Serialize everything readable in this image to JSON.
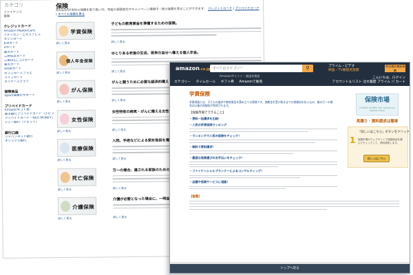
{
  "back_page": {
    "category": "カテゴリ",
    "title": "保険",
    "intro_text": "Amazonが当社の保険を取り扱い中、特定の保険会社やキャンペーン情報中・他の保険を見ることができます：",
    "intro_links": [
      "クレジットカード",
      "プリペイドカード",
      "すべての保険を見る"
    ],
    "sidebar": {
      "top_links": [
        "ファイナンス",
        "保険"
      ],
      "sections": [
        {
          "title": "クレジットカード",
          "items": [
            "Amazon MasterCard",
            "アメリカン・エキスプレス",
            "セゾンカード",
            "JCBカード",
            "dカード",
            "楽天カード",
            "三井住友カード",
            "三菱UFJニコスカード",
            "楽天カード",
            "VIEWカード",
            "セブンカードプラス",
            "ライフカード",
            "ダイナースクラブ"
          ]
        },
        {
          "title": "保険商品",
          "items": [
            "Spark保険のサポート"
          ]
        },
        {
          "title": "プリペイドカード",
          "items": [
            "Amazonギフト券",
            "楽天銀行プリペイドカード（デビット）",
            "プリペイドカード「NEO MONEY」",
            "ソニー銀行（デビット）"
          ]
        },
        {
          "title": "銀行口座",
          "items": [
            "ジャパンネット銀行",
            "オリックス銀行"
          ]
        }
      ]
    },
    "products": [
      {
        "banner": "学資保険",
        "headline": "子どもの教育資金を準備するための保険。",
        "more": "詳しく見る"
      },
      {
        "banner": "個人年金保険",
        "headline": "ゆとりある老後の生活、将来の自分へ備える個人年金。",
        "more": "詳しく見る"
      },
      {
        "banner": "がん保険",
        "headline": "がんと闘うために必要な経済的備え",
        "more": "詳しく見る"
      },
      {
        "banner": "女性保険",
        "headline": "女性特有の病気・がんに備える女性保険",
        "more": "詳しく見る"
      },
      {
        "banner": "医療保険",
        "headline": "入院、手術などによる家計負担を備える医療保険",
        "more": "詳しく見る"
      },
      {
        "banner": "死亡保険",
        "headline": "万一の場合、遺される家族のための保険",
        "more": "詳しく見る"
      },
      {
        "banner": "介護保険",
        "headline": "介護が必要となった場合に、一時金や年金",
        "more": "詳しく見る"
      }
    ]
  },
  "front_page": {
    "nav": {
      "logo": "amazon",
      "logo_sub": ".co.jp",
      "search_placeholder": "すべてのカテゴリー",
      "prime_line1": "プライム・ビデオ",
      "prime_line2": "映画・TV番組見放題",
      "promo": "30日間の無料体験",
      "subline": "Amazonポイント・発送先指定",
      "links": [
        "カテゴリー",
        "タイムセール",
        "ギフト券",
        "Amazonで販売"
      ],
      "account": "こんにちは、ログイン",
      "account_sub": "アカウント＆リスト",
      "orders": "注文履歴",
      "prime": "プライム",
      "cart": "カート",
      "cart_icon": "cart-icon",
      "search_icon": "search-icon"
    },
    "title": "学資保険",
    "intro": "学資保険とは、子どもの進学や教育資金を積み立てる保険です。満期金を受け取るまでの保険料を払い込み、親の万一の場合は以後の保険料が免除されます。",
    "section_heading": "【保険市場でできること】",
    "features": [
      {
        "head": "・資料一括請求を比較！"
      },
      {
        "head": "・人気の学資保険ランキング"
      },
      {
        "head": "・ランキングで人気の保険をチェック！"
      },
      {
        "head": "・無料で資料請求！"
      },
      {
        "head": "・最適な保険選びのお手伝いをチェック！"
      },
      {
        "head": "・ファイナンシャルプランナーによるコンサルティング！"
      },
      {
        "head": "・店舗や保険サービスに相談！"
      }
    ],
    "notes_heading": "【留意】",
    "side_ad": {
      "brand": "保険市場",
      "brand_sub": "HOKEN ICHIBA The Insurance Market Place",
      "tagline": "見積り・資料請求は簡単",
      "step_num": "1",
      "step_title": "「詳しいはこちら」ボタンをクリック",
      "step_desc": "保険市場のウェブサイトで保険商品を選んでチェックして、資料請求します。",
      "button": "詳しいはこちら"
    },
    "footer": "トップへ戻る"
  }
}
